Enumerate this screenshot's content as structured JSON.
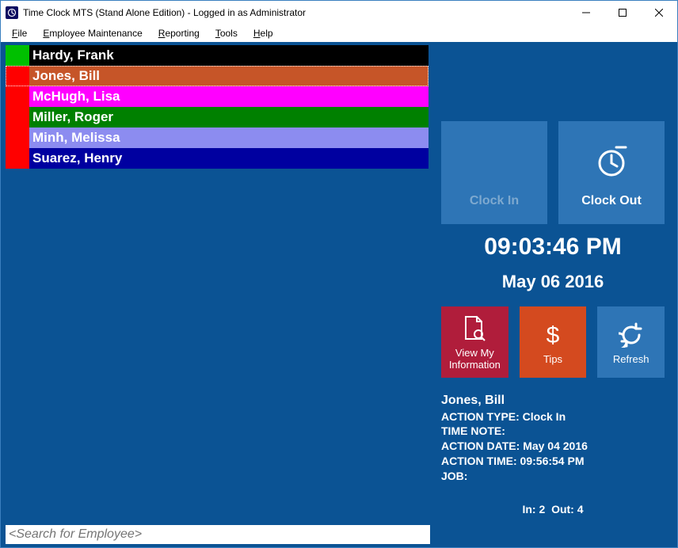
{
  "window": {
    "title": "Time Clock MTS (Stand Alone Edition)  - Logged in as Administrator"
  },
  "menubar": {
    "file": "File",
    "employee_maintenance": "Employee Maintenance",
    "reporting": "Reporting",
    "tools": "Tools",
    "help": "Help"
  },
  "employees": [
    {
      "swatch": "#00c000",
      "bg": "#000000",
      "name": "Hardy, Frank"
    },
    {
      "swatch": "#ff0000",
      "bg": "#c65528",
      "name": "Jones, Bill"
    },
    {
      "swatch": "#ff0000",
      "bg": "#ff00ff",
      "name": "McHugh, Lisa"
    },
    {
      "swatch": "#ff0000",
      "bg": "#008000",
      "name": "Miller, Roger"
    },
    {
      "swatch": "#ff0000",
      "bg": "#8c8cf0",
      "name": "Minh, Melissa"
    },
    {
      "swatch": "#ff0000",
      "bg": "#0000a0",
      "name": "Suarez, Henry"
    }
  ],
  "selected_index": 1,
  "search": {
    "placeholder": "<Search for Employee>"
  },
  "clock": {
    "clock_in_label": "Clock In",
    "clock_out_label": "Clock Out",
    "time": "09:03:46 PM",
    "date": "May 06 2016"
  },
  "actions": {
    "view_info_label": "View My Information",
    "tips_label": "Tips",
    "refresh_label": "Refresh"
  },
  "details": {
    "name": "Jones, Bill",
    "action_type_label": "ACTION TYPE:",
    "action_type_value": "Clock In",
    "time_note_label": "TIME NOTE:",
    "time_note_value": "",
    "action_date_label": "ACTION DATE:",
    "action_date_value": "May 04 2016",
    "action_time_label": "ACTION TIME:",
    "action_time_value": "09:56:54 PM",
    "job_label": "JOB:",
    "job_value": ""
  },
  "counts": {
    "in_label": "In:",
    "in_value": "2",
    "out_label": "Out:",
    "out_value": "4"
  }
}
